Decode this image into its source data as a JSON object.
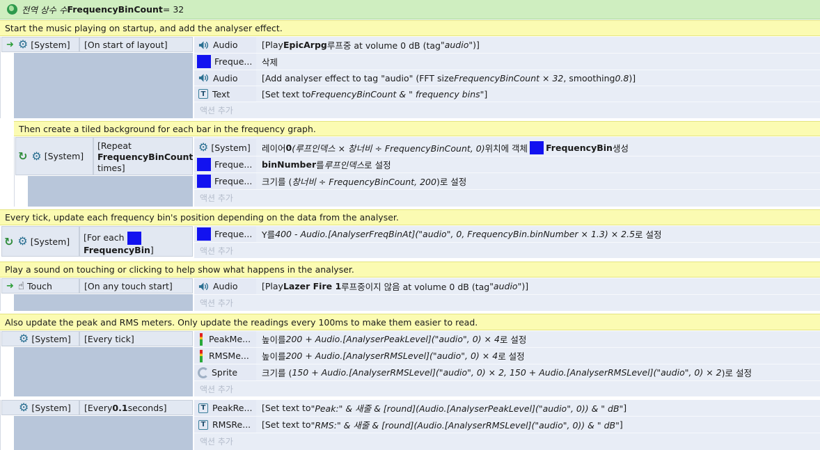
{
  "global_var": {
    "prefix": "전역 상수 수 ",
    "name": "FrequencyBinCount",
    "value": " = 32"
  },
  "labels": {
    "system": "[System]",
    "add_action": "액션 추가",
    "touch": "Touch"
  },
  "block1": {
    "comment": "Start the music playing on startup, and add the analyser effect.",
    "condition": "[On start of layout]",
    "actions": [
      {
        "object": "Audio",
        "icon": "speaker-icon",
        "pre": "[Play ",
        "bold": "EpicArpg",
        "mid": " 루프중 at volume 0 dB (tag ",
        "it": "\"audio\"",
        "post": ")]"
      },
      {
        "object": "Freque...",
        "icon": "blue-sprite-icon",
        "text": "삭제"
      },
      {
        "object": "Audio",
        "icon": "speaker-icon",
        "pre": "[Add analyser effect to tag \"audio\" (FFT size ",
        "it": "FrequencyBinCount × 32",
        "mid": ", smoothing ",
        "it2": "0.8",
        "post": ")]"
      },
      {
        "object": "Text",
        "icon": "text-icon",
        "pre": "[Set text to ",
        "it": "FrequencyBinCount & \" frequency bins\"",
        "post": "]"
      }
    ]
  },
  "block2": {
    "comment": "Then create a tiled background for each bar in the frequency graph.",
    "condition": {
      "pre": "[Repeat",
      "bold": "FrequencyBinCount",
      "post": "times]"
    },
    "actions": [
      {
        "object": "[System]",
        "icon": "gear-icon",
        "pre": "레이어 ",
        "bold": "0",
        "it": " (루프인덱스 × 창너비 ÷ FrequencyBinCount, 0)",
        "mid": " 위치에 객체 ",
        "bold2": "FrequencyBin",
        "post": " 생성"
      },
      {
        "object": "Freque...",
        "icon": "blue-sprite-icon",
        "bold": "binNumber",
        "mid": " 를 ",
        "it": "루프인덱스",
        "post": " 로 설정"
      },
      {
        "object": "Freque...",
        "icon": "blue-sprite-icon",
        "pre": "크기를 (",
        "it": "창너비 ÷ FrequencyBinCount, 200",
        "post": ")로 설정"
      }
    ]
  },
  "block3": {
    "comment": "Every tick, update each frequency bin's position depending on the data from the analyser.",
    "condition": {
      "pre": "[For each",
      "bold": "FrequencyBin",
      "post": "]"
    },
    "actions": [
      {
        "object": "Freque...",
        "icon": "blue-sprite-icon",
        "pre": "Y를 ",
        "it": "400 - Audio.[AnalyserFreqBinAt](\"audio\", 0, FrequencyBin.binNumber × 1.3) × 2.5",
        "post": "로 설정"
      }
    ]
  },
  "block4": {
    "comment": "Play a sound on touching or clicking to help show what happens in the analyser.",
    "condition": "[On any touch start]",
    "actions": [
      {
        "object": "Audio",
        "icon": "speaker-icon",
        "pre": "[Play ",
        "bold": "Lazer Fire 1",
        "mid": " 루프중이지 않음 at volume 0 dB (tag ",
        "it": "\"audio\"",
        "post": ")]"
      }
    ]
  },
  "block5": {
    "comment": "Also update the peak and RMS meters. Only update the readings every 100ms to make them easier to read.",
    "condition": "[Every tick]",
    "actions": [
      {
        "object": "PeakMe...",
        "icon": "meter-icon",
        "pre": "높이를 ",
        "it": "200 + Audio.[AnalyserPeakLevel](\"audio\", 0) × 4",
        "post": "로 설정"
      },
      {
        "object": "RMSMe...",
        "icon": "meter-icon",
        "pre": "높이를 ",
        "it": "200 + Audio.[AnalyserRMSLevel](\"audio\", 0) × 4",
        "post": "로 설정"
      },
      {
        "object": "Sprite",
        "icon": "sprite-icon",
        "pre": "크기를 (",
        "it": "150 + Audio.[AnalyserRMSLevel](\"audio\", 0) × 2, 150 + Audio.[AnalyserRMSLevel](\"audio\", 0) × 2",
        "post": ")로 설정"
      }
    ]
  },
  "block6": {
    "condition": {
      "pre": "[Every ",
      "bold": "0.1",
      "post": " seconds]"
    },
    "actions": [
      {
        "object": "PeakRe...",
        "icon": "text-icon",
        "pre": "[Set text to ",
        "it": "\"Peak:\" & 새줄 & [round](Audio.[AnalyserPeakLevel](\"audio\", 0)) & \" dB\"",
        "post": "]"
      },
      {
        "object": "RMSRe...",
        "icon": "text-icon",
        "pre": "[Set text to ",
        "it": "\"RMS:\" & 새줄 & [round](Audio.[AnalyserRMSLevel](\"audio\", 0)) & \" dB\"",
        "post": "]"
      }
    ]
  }
}
